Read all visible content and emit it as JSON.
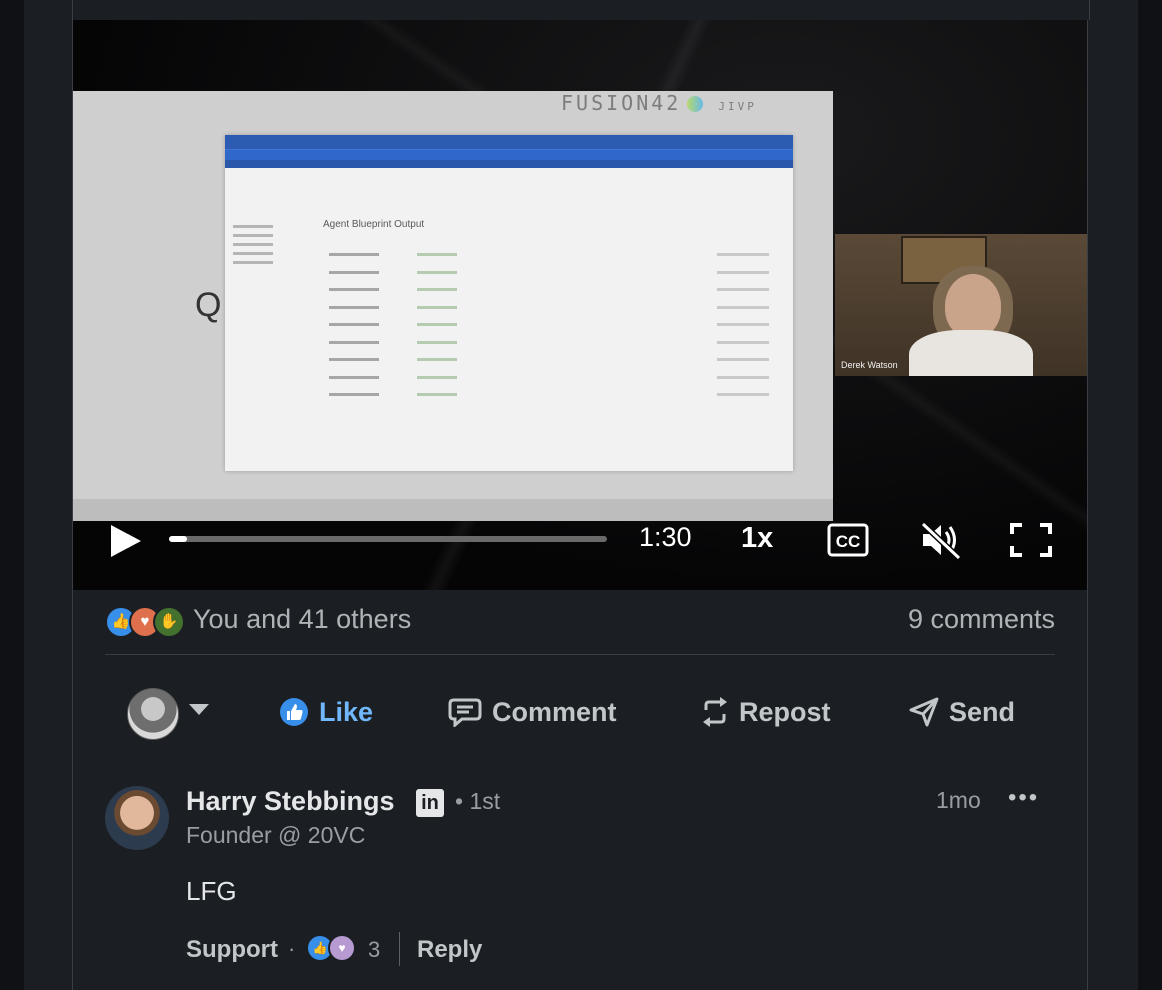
{
  "video": {
    "slide_brand": "FUSION42",
    "slide_brand_suffix": "JIVP",
    "slide_letter": "Q",
    "app_title": "Agent Blueprint Output",
    "speaker_name": "Derek Watson",
    "time": "1:30",
    "speed": "1x",
    "progress": 0.04
  },
  "social": {
    "reactions": [
      "like-icon",
      "love-icon",
      "celebrate-icon"
    ],
    "reaction_text": "You and 41 others",
    "comments_count": "9 comments"
  },
  "actions": {
    "like": "Like",
    "comment": "Comment",
    "repost": "Repost",
    "send": "Send"
  },
  "comment": {
    "author": "Harry Stebbings",
    "degree": "• 1st",
    "headline": "Founder @ 20VC",
    "time": "1mo",
    "more": "•••",
    "body": "LFG",
    "support_label": "Support",
    "dot": "·",
    "reaction_count": "3",
    "reply_label": "Reply"
  },
  "colors": {
    "background": "#1b1f23",
    "like_accent": "#71b7fb",
    "text_muted": "#9a9ea2"
  }
}
